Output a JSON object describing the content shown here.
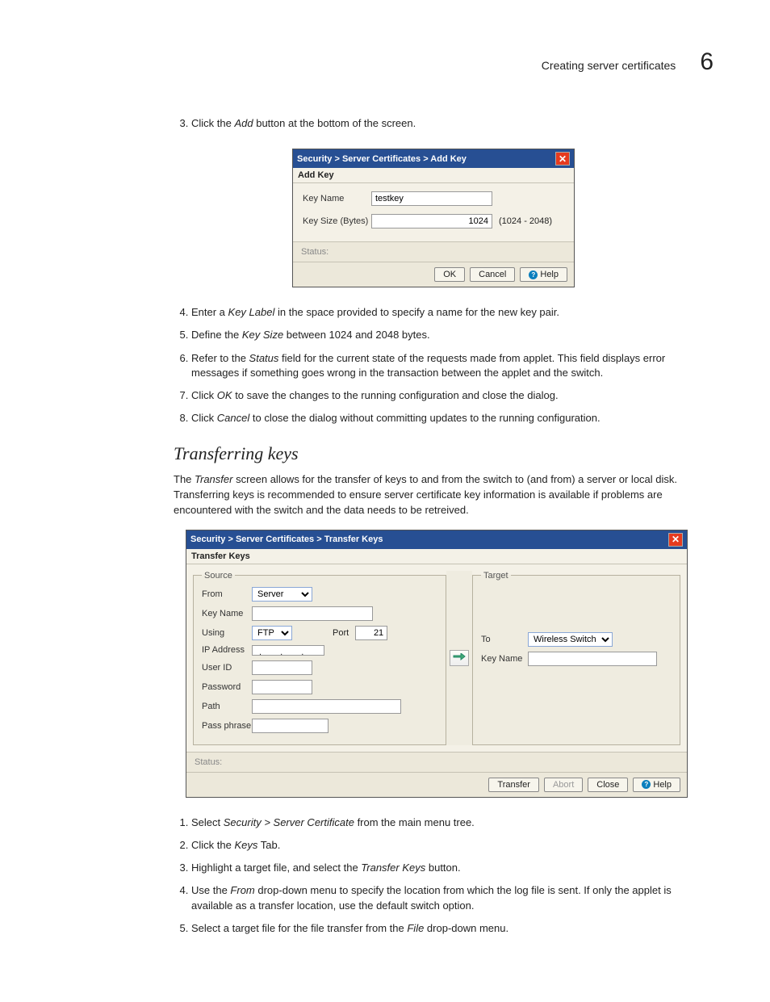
{
  "header": {
    "title": "Creating server certificates",
    "chapter": "6"
  },
  "stepsA": [
    {
      "num": "3.",
      "pre": "Click the ",
      "it1": "Add",
      "post": " button at the bottom of the screen."
    }
  ],
  "addKey": {
    "breadcrumb": "Security > Server Certificates > Add Key",
    "subtitle": "Add Key",
    "keyNameLabel": "Key Name",
    "keyNameValue": "testkey",
    "keySizeLabel": "Key Size (Bytes)",
    "keySizeValue": "1024",
    "keySizeHint": "(1024 - 2048)",
    "statusLabel": "Status:",
    "ok": "OK",
    "cancel": "Cancel",
    "help": "Help"
  },
  "stepsB": [
    {
      "num": "4.",
      "text_parts": [
        "Enter a ",
        "Key Label",
        " in the space provided to specify a name for the new key pair."
      ]
    },
    {
      "num": "5.",
      "text_parts": [
        "Define the ",
        "Key Size",
        " between 1024 and 2048 bytes."
      ]
    },
    {
      "num": "6.",
      "text_parts": [
        "Refer to the ",
        "Status",
        " field for the current state of the requests made from applet. This field displays error messages if something goes wrong in the transaction between the applet and the switch."
      ]
    },
    {
      "num": "7.",
      "text_parts": [
        "Click ",
        "OK",
        " to save the changes to the running configuration and close the dialog."
      ]
    },
    {
      "num": "8.",
      "text_parts": [
        "Click ",
        "Cancel",
        " to close the dialog without committing updates to the running configuration."
      ]
    }
  ],
  "section": {
    "heading": "Transferring keys"
  },
  "paraTransfer": {
    "pre": "The ",
    "it": "Transfer",
    "post": " screen allows for the transfer of keys to and from the switch to (and from) a server or local disk. Transferring keys is recommended to ensure server certificate key information is available if problems are encountered with the switch and the data needs to be retreived."
  },
  "transfer": {
    "breadcrumb": "Security > Server Certificates > Transfer Keys",
    "subtitle": "Transfer Keys",
    "source": {
      "legend": "Source",
      "fromLabel": "From",
      "fromValue": "Server",
      "keyNameLabel": "Key Name",
      "keyNameValue": "",
      "usingLabel": "Using",
      "usingValue": "FTP",
      "portLabel": "Port",
      "portValue": "21",
      "ipLabel": "IP Address",
      "userLabel": "User ID",
      "userValue": "",
      "passLabel": "Password",
      "passValue": "",
      "pathLabel": "Path",
      "pathValue": "",
      "phraseLabel": "Pass phrase",
      "phraseValue": ""
    },
    "target": {
      "legend": "Target",
      "toLabel": "To",
      "toValue": "Wireless Switch",
      "keyNameLabel": "Key Name",
      "keyNameValue": ""
    },
    "statusLabel": "Status:",
    "btnTransfer": "Transfer",
    "btnAbort": "Abort",
    "btnClose": "Close",
    "btnHelp": "Help"
  },
  "stepsC": [
    {
      "num": "1.",
      "text_parts": [
        "Select ",
        "Security > Server Certificate",
        " from the main menu tree."
      ]
    },
    {
      "num": "2.",
      "text_parts": [
        "Click the ",
        "Keys",
        " Tab."
      ]
    },
    {
      "num": "3.",
      "text_parts": [
        "Highlight a target file, and select the ",
        "Transfer Keys",
        " button."
      ]
    },
    {
      "num": "4.",
      "text_parts": [
        "Use the ",
        "From",
        " drop-down menu to specify the location from which the log file is sent. If only the applet is available as a transfer location, use the default switch option."
      ]
    },
    {
      "num": "5.",
      "text_parts": [
        "Select a target file for the file transfer from the ",
        "File",
        " drop-down menu."
      ]
    }
  ]
}
